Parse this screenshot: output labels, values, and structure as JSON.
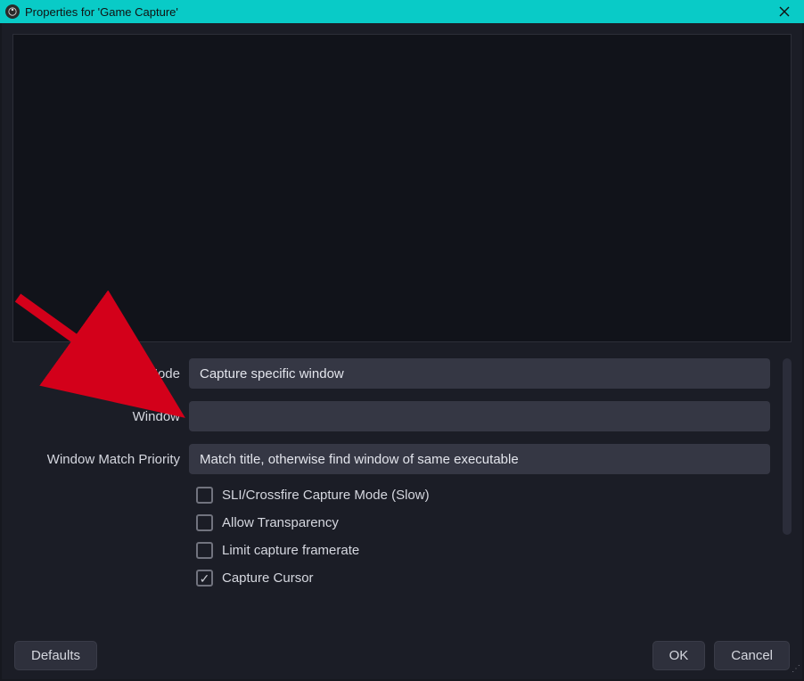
{
  "window": {
    "title": "Properties for 'Game Capture'"
  },
  "form": {
    "mode": {
      "label": "Mode",
      "value": "Capture specific window"
    },
    "window": {
      "label": "Window",
      "value": ""
    },
    "priority": {
      "label": "Window Match Priority",
      "value": "Match title, otherwise find window of same executable"
    },
    "check_sli": "SLI/Crossfire Capture Mode (Slow)",
    "check_transparency": "Allow Transparency",
    "check_framerate": "Limit capture framerate",
    "check_cursor": "Capture Cursor"
  },
  "buttons": {
    "defaults": "Defaults",
    "ok": "OK",
    "cancel": "Cancel"
  }
}
